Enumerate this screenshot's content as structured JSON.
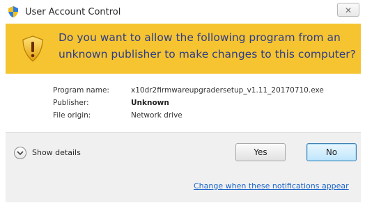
{
  "window": {
    "title": "User Account Control",
    "close_glyph": "✕"
  },
  "banner": {
    "question": "Do you want to allow the following program from an unknown publisher to make changes to this computer?",
    "icon": "uac-shield-warning-icon",
    "background": "#f5c430"
  },
  "info": {
    "rows": [
      {
        "label": "Program name:",
        "value": "x10dr2firmwareupgradersetup_v1.11_20170710.exe"
      },
      {
        "label": "Publisher:",
        "value": "Unknown"
      },
      {
        "label": "File origin:",
        "value": "Network drive"
      }
    ]
  },
  "footer": {
    "show_details_label": "Show details",
    "yes_label": "Yes",
    "no_label": "No",
    "link_text": "Change when these notifications appear",
    "link_color": "#1b64c8"
  }
}
